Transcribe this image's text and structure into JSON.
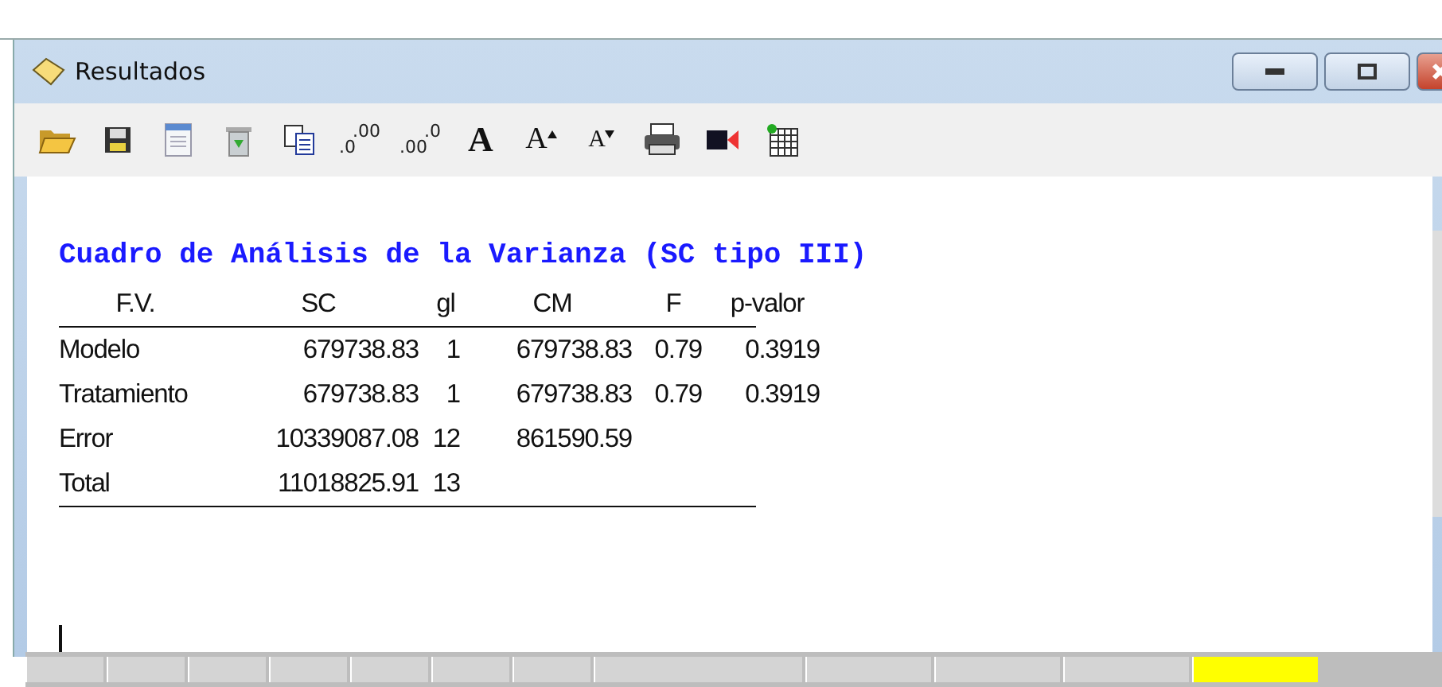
{
  "window": {
    "title": "Resultados"
  },
  "toolbar": [
    {
      "kind": "open"
    },
    {
      "kind": "save"
    },
    {
      "kind": "document"
    },
    {
      "kind": "trash"
    },
    {
      "kind": "copy"
    },
    {
      "kind": "digits",
      "top": ".00",
      "bottom": ".0"
    },
    {
      "kind": "digits",
      "top": ".0",
      "bottom": ".00"
    },
    {
      "kind": "bold",
      "label": "A"
    },
    {
      "kind": "grow",
      "label": "A"
    },
    {
      "kind": "shrink",
      "label": "A"
    },
    {
      "kind": "printer"
    },
    {
      "kind": "marker"
    },
    {
      "kind": "grid"
    }
  ],
  "report": {
    "title": "Cuadro de Análisis de la Varianza (SC tipo III)",
    "columns": [
      "F.V.",
      "SC",
      "gl",
      "CM",
      "F",
      "p-valor"
    ],
    "rows": [
      [
        "Modelo",
        "679738.83",
        "1",
        "679738.83",
        "0.79",
        "0.3919"
      ],
      [
        "Tratamiento",
        "679738.83",
        "1",
        "679738.83",
        "0.79",
        "0.3919"
      ],
      [
        "Error",
        "10339087.08",
        "12",
        "861590.59",
        "",
        ""
      ],
      [
        "Total",
        "11018825.91",
        "13",
        "",
        "",
        ""
      ]
    ]
  }
}
